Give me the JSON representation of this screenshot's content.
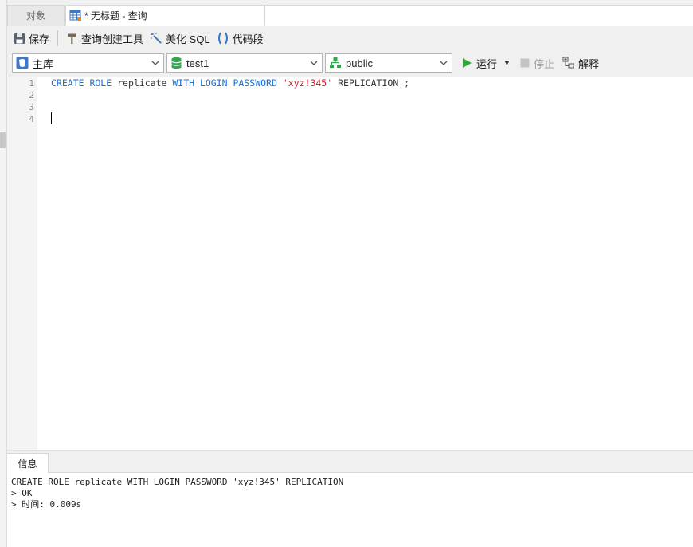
{
  "tabs": {
    "objects_label": "对象",
    "query_label": "* 无标题 - 查询"
  },
  "toolbar": {
    "save_label": "保存",
    "builder_label": "查询创建工具",
    "beautify_label": "美化 SQL",
    "snippet_label": "代码段"
  },
  "selectors": {
    "connection": "主库",
    "database": "test1",
    "schema": "public"
  },
  "actions": {
    "run_label": "运行",
    "stop_label": "停止",
    "explain_label": "解释"
  },
  "editor": {
    "line_numbers": [
      "1",
      "2",
      "3",
      "4"
    ],
    "tokens": {
      "t1": "CREATE ROLE",
      "t2": " replicate ",
      "t3": "WITH LOGIN PASSWORD",
      "t4": " 'xyz!345'",
      "t5": " REPLICATION ;"
    }
  },
  "bottom": {
    "tab_label": "信息",
    "lines": [
      "CREATE ROLE replicate WITH LOGIN PASSWORD 'xyz!345' REPLICATION",
      "> OK",
      "> 时间: 0.009s"
    ]
  },
  "colors": {
    "keyword": "#1a6fd6",
    "string": "#d11a2a",
    "run_green": "#2eaa3a"
  }
}
